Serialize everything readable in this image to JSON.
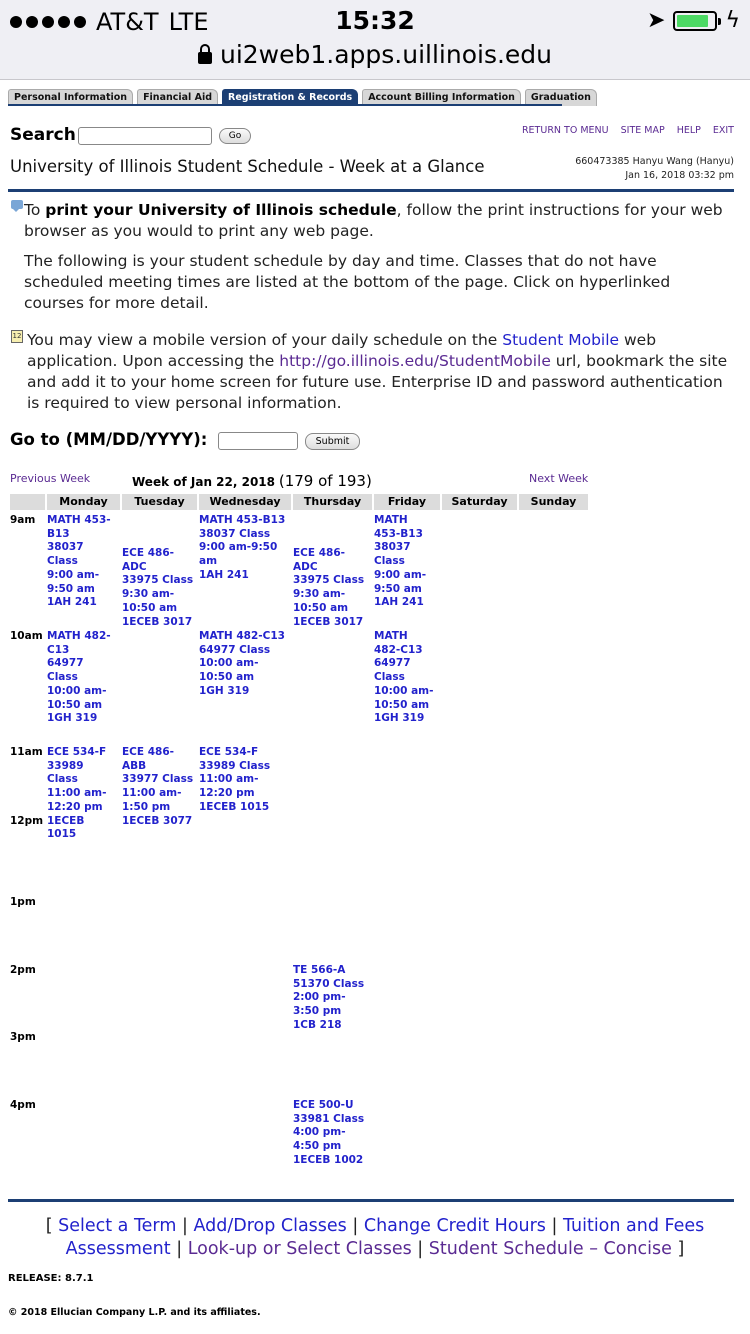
{
  "status_bar": {
    "carrier": "AT&T",
    "network": "LTE",
    "time": "15:32",
    "url": "ui2web1.apps.uillinois.edu",
    "battery_level": 0.85
  },
  "tabs": [
    {
      "label": "Personal Information",
      "active": false
    },
    {
      "label": "Financial Aid",
      "active": false
    },
    {
      "label": "Registration & Records",
      "active": true
    },
    {
      "label": "Account Billing Information",
      "active": false
    },
    {
      "label": "Graduation",
      "active": false
    }
  ],
  "header": {
    "search_label": "Search",
    "go_label": "Go",
    "links": [
      "RETURN TO MENU",
      "SITE MAP",
      "HELP",
      "EXIT"
    ],
    "page_title": "University of Illinois Student Schedule - Week at a Glance",
    "user_line": "660473385 Hanyu Wang (Hanyu)",
    "date_line": "Jan 16, 2018 03:32 pm"
  },
  "info": {
    "print_prefix": "To ",
    "print_bold": "print your University of Illinois schedule",
    "print_suffix": ", follow the print instructions for your web browser as you would to print any web page.",
    "schedule_text": "The following is your student schedule by day and time. Classes that do not have scheduled meeting times are listed at the bottom of the page. Click on hyperlinked courses for more detail.",
    "mobile_prefix": "You may view a mobile version of your daily schedule on the ",
    "mobile_link": "Student Mobile",
    "mobile_mid": " web application. Upon accessing the ",
    "mobile_url": "http://go.illinois.edu/StudentMobile",
    "mobile_suffix": " url, bookmark the site and add it to your home screen for future use. Enterprise ID and password authentication is required to view personal information.",
    "calendar_icon_text": "12"
  },
  "goto": {
    "label": "Go to (MM/DD/YYYY):",
    "submit_label": "Submit"
  },
  "week_nav": {
    "previous": "Previous Week",
    "next": "Next Week",
    "week_of": "Week of Jan 22, 2018",
    "count": "(179 of 193)"
  },
  "days": [
    "Monday",
    "Tuesday",
    "Wednesday",
    "Thursday",
    "Friday",
    "Saturday",
    "Sunday"
  ],
  "times": [
    "9am",
    "10am",
    "11am",
    "12pm",
    "1pm",
    "2pm",
    "3pm",
    "4pm"
  ],
  "classes": [
    {
      "day": "Monday",
      "text": "MATH 453-\nB13\n38037\nClass\n9:00 am-\n9:50 am\n1AH 241"
    },
    {
      "day": "Tuesday",
      "text": "ECE 486-\nADC\n33975 Class\n9:30 am-\n10:50 am\n1ECEB 3017"
    },
    {
      "day": "Wednesday",
      "text": "MATH 453-B13\n38037 Class\n9:00 am-9:50\nam\n1AH 241"
    },
    {
      "day": "Thursday",
      "text": "ECE 486-\nADC\n33975 Class\n9:30 am-\n10:50 am\n1ECEB 3017"
    },
    {
      "day": "Friday",
      "text": "MATH\n453-B13\n38037\nClass\n9:00 am-\n9:50 am\n1AH 241"
    },
    {
      "day": "Monday",
      "text": "MATH 482-\nC13\n64977\nClass\n10:00 am-\n10:50 am\n1GH 319"
    },
    {
      "day": "Wednesday",
      "text": "MATH 482-C13\n64977 Class\n10:00 am-\n10:50 am\n1GH 319"
    },
    {
      "day": "Friday",
      "text": "MATH\n482-C13\n64977\nClass\n10:00 am-\n10:50 am\n1GH 319"
    },
    {
      "day": "Monday",
      "text": "ECE 534-F\n33989\nClass\n11:00 am-\n12:20 pm\n1ECEB\n1015"
    },
    {
      "day": "Tuesday",
      "text": "ECE 486-\nABB\n33977 Class\n11:00 am-\n1:50 pm\n1ECEB 3077"
    },
    {
      "day": "Wednesday",
      "text": "ECE 534-F\n33989 Class\n11:00 am-\n12:20 pm\n1ECEB 1015"
    },
    {
      "day": "Thursday",
      "text": "TE 566-A\n51370 Class\n2:00 pm-\n3:50 pm\n1CB 218"
    },
    {
      "day": "Thursday",
      "text": "ECE 500-U\n33981 Class\n4:00 pm-\n4:50 pm\n1ECEB 1002"
    }
  ],
  "footer": {
    "open_bracket": "[",
    "close_bracket": "]",
    "separator": "|",
    "links": [
      "Select a Term",
      "Add/Drop Classes",
      "Change Credit Hours",
      "Tuition and Fees Assessment",
      "Look-up or Select Classes",
      "Student Schedule – Concise"
    ],
    "release": "RELEASE: 8.7.1",
    "copyright": "© 2018 Ellucian Company L.P. and its affiliates."
  }
}
